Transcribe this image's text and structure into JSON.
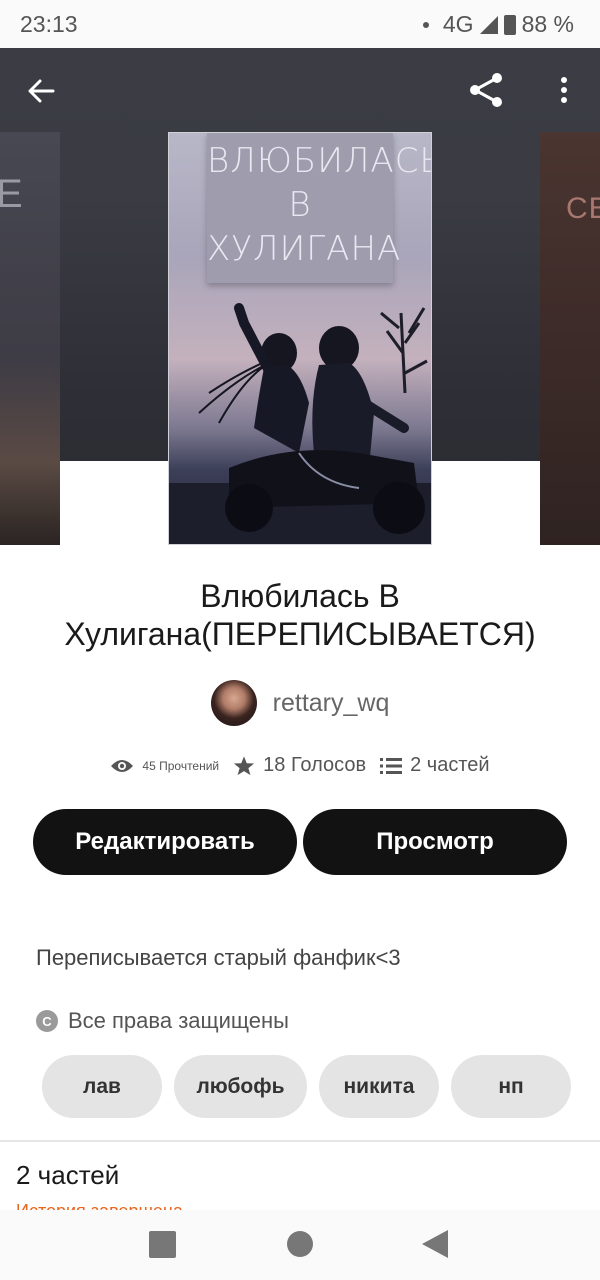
{
  "status_bar": {
    "time": "23:13",
    "network": "4G",
    "battery": "88 %"
  },
  "toolbar": {
    "back_icon": "arrow-left-icon",
    "share_icon": "share-icon",
    "more_icon": "more-vertical-icon"
  },
  "cover": {
    "title_lines": [
      "ВЛЮБИЛАСЬ",
      "В",
      "ХУЛИГАНА"
    ],
    "left_fragment": "Е",
    "right_fragment": "СВЕ"
  },
  "story": {
    "title": "Влюбилась В Хулигана(ПЕРЕПИСЫВАЕТСЯ)",
    "author": "rettary_wq",
    "reads": "45 Прочтений",
    "votes": "18 Голосов",
    "parts": "2 частей",
    "description": "Переписывается старый фанфик<3",
    "copyright": "Все права защищены"
  },
  "buttons": {
    "edit": "Редактировать",
    "view": "Просмотр"
  },
  "tags": [
    "лав",
    "любофь",
    "никита",
    "нп"
  ],
  "parts_section": {
    "heading": "2 частей",
    "status": "История завершена"
  },
  "colors": {
    "button_bg": "#121212",
    "tag_bg": "#e4e4e4",
    "accent": "#e8661e"
  }
}
